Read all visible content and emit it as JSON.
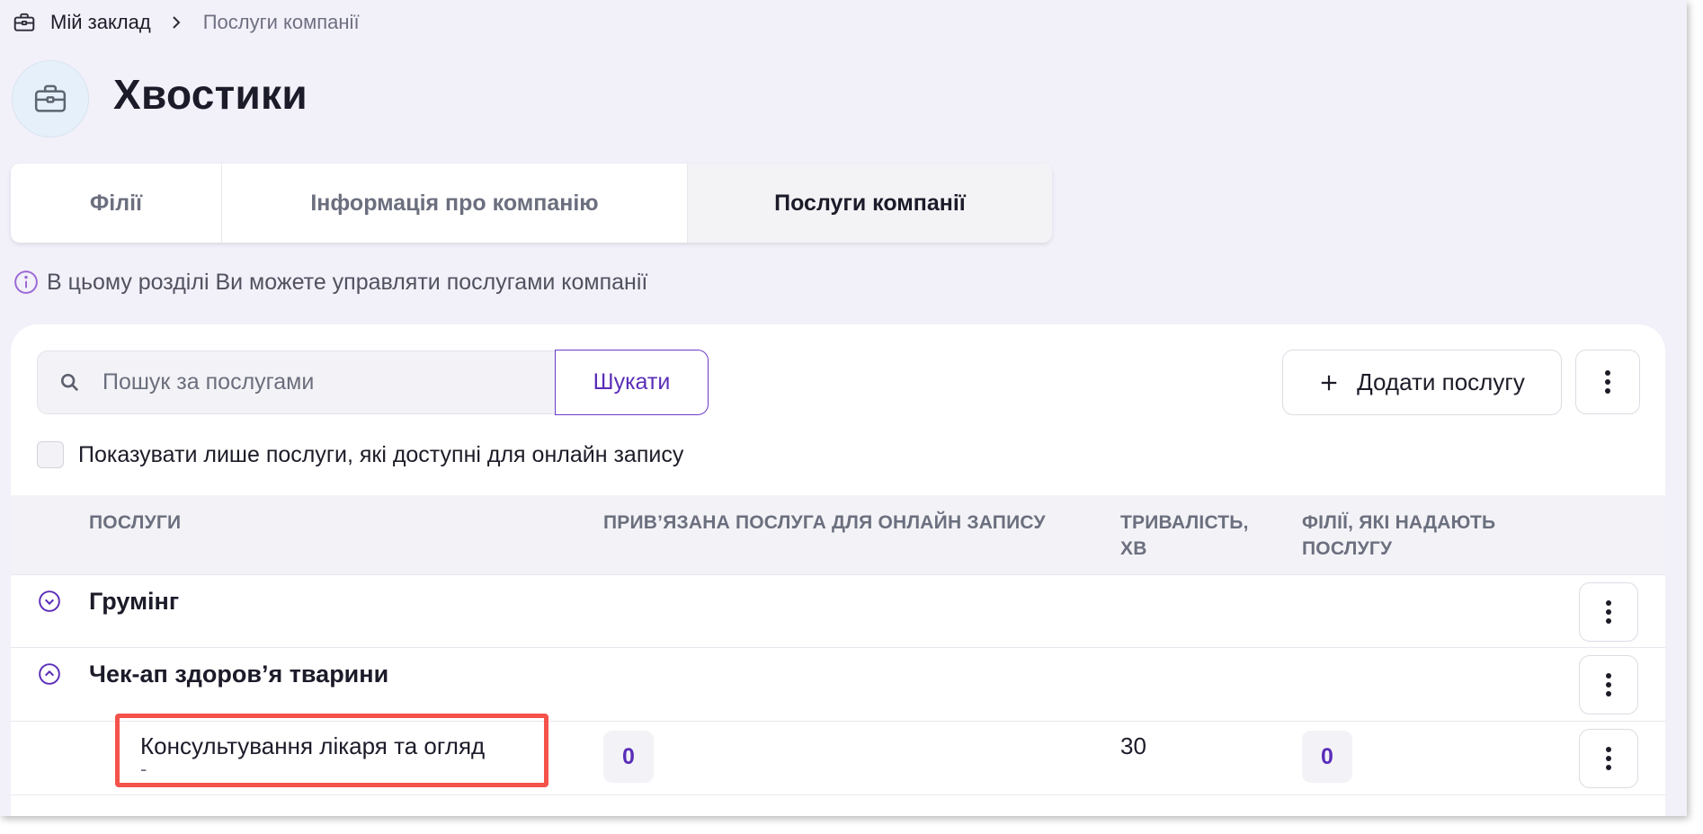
{
  "breadcrumb": {
    "home": "Мій заклад",
    "current": "Послуги компанії"
  },
  "header": {
    "title": "Хвостики"
  },
  "tabs": [
    {
      "label": "Філії"
    },
    {
      "label": "Інформація про компанію"
    },
    {
      "label": "Послуги компанії",
      "active": true
    }
  ],
  "info": {
    "text": "В цьому розділі Ви можете управляти послугами компанії"
  },
  "toolbar": {
    "search_placeholder": "Пошук за послугами",
    "search_value": "",
    "search_button": "Шукати",
    "add_button": "Додати послугу"
  },
  "filter": {
    "label": "Показувати лише послуги, які доступні для онлайн запису",
    "checked": false
  },
  "table": {
    "columns": [
      "Послуги",
      "Прив’язана послуга для онлайн запису",
      "Тривалість, хв",
      "Філії, які надають послугу"
    ],
    "groups": [
      {
        "name": "Грумінг",
        "expanded": false
      },
      {
        "name": "Чек-ап здоров’я тварини",
        "expanded": true,
        "services": [
          {
            "name": "Консультування лікаря та огляд",
            "subtitle": "-",
            "linked_online": "0",
            "duration": "30",
            "branches": "0"
          }
        ]
      }
    ]
  },
  "colors": {
    "accent": "#5a2db8",
    "highlight": "#f4524a",
    "background": "#f2f0f9"
  }
}
